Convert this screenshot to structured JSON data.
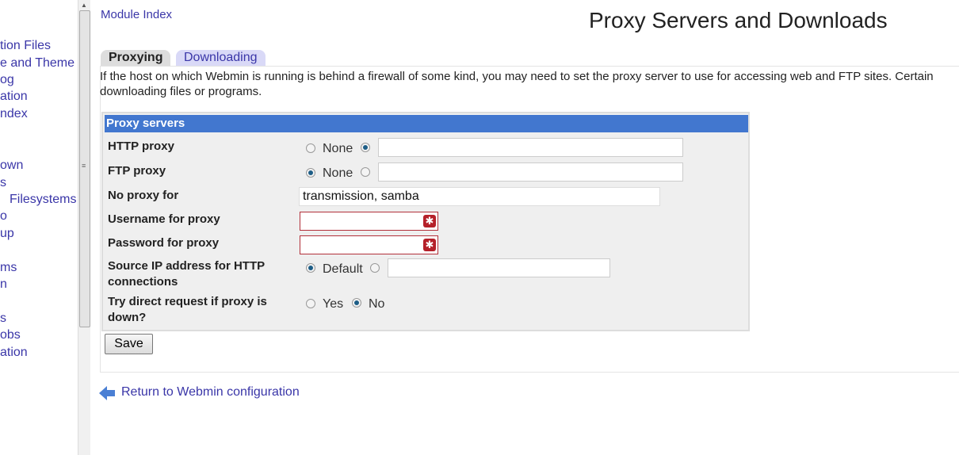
{
  "sidebar": {
    "items": [
      "tion Files",
      "e and Theme",
      "og",
      "ation",
      "ndex",
      "own",
      "s",
      "Filesystems",
      "o",
      "up",
      "ms",
      "n",
      "s",
      "obs",
      "ation"
    ]
  },
  "header": {
    "module_index": "Module Index",
    "title": "Proxy Servers and Downloads"
  },
  "tabs": [
    {
      "label": "Proxying",
      "active": true
    },
    {
      "label": "Downloading",
      "active": false
    }
  ],
  "description": "If the host on which Webmin is running is behind a firewall of some kind, you may need to set the proxy server to use for accessing web and FTP sites. Certain",
  "description2": "downloading files or programs.",
  "form": {
    "title": "Proxy servers",
    "http_proxy": {
      "label": "HTTP proxy",
      "none": "None",
      "selected": "custom",
      "value": ""
    },
    "ftp_proxy": {
      "label": "FTP proxy",
      "none": "None",
      "selected": "none",
      "value": ""
    },
    "no_proxy": {
      "label": "No proxy for",
      "value": "transmission, samba"
    },
    "username": {
      "label": "Username for proxy",
      "value": ""
    },
    "password": {
      "label": "Password for proxy",
      "value": ""
    },
    "source_ip": {
      "label1": "Source IP address for HTTP",
      "label2": "connections",
      "default": "Default",
      "selected": "default",
      "value": ""
    },
    "direct": {
      "label1": "Try direct request if proxy is",
      "label2": "down?",
      "yes": "Yes",
      "no": "No",
      "selected": "no"
    },
    "save": "Save"
  },
  "footer": {
    "return_link": "Return to Webmin configuration"
  },
  "colors": {
    "header": "#4277cf",
    "link": "#3a36a8",
    "required": "#b52029"
  }
}
